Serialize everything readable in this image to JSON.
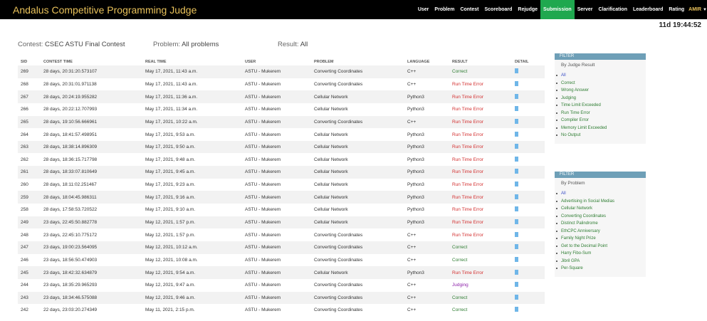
{
  "navbar": {
    "brand": "Andalus Competitive Programming Judge",
    "items": [
      "User",
      "Problem",
      "Contest",
      "Scoreboard",
      "Rejudge",
      "Submission",
      "Server",
      "Clarification",
      "Leaderboard",
      "Rating"
    ],
    "active": "Submission",
    "user": "AMIR"
  },
  "timer": "11d 19:44:52",
  "filters": {
    "contest_label": "Contest: ",
    "contest_value": "CSEC ASTU Final Contest",
    "problem_label": "Problem: ",
    "problem_value": "All problems",
    "result_label": "Result: ",
    "result_value": "All"
  },
  "table": {
    "headers": [
      "SID",
      "CONTEST TIME",
      "REAL TIME",
      "USER",
      "PROBLEM",
      "LANGUAGE",
      "RESULT",
      "DETAIL"
    ],
    "rows": [
      {
        "sid": "269",
        "contest_time": "28 days, 20:31:20.573107",
        "real_time": "May 17, 2021, 11:43 a.m.",
        "user": "ASTU - Mukerem",
        "problem": "Converting Coordinates",
        "language": "C++",
        "result": "Correct"
      },
      {
        "sid": "268",
        "contest_time": "28 days, 20:31:01.971138",
        "real_time": "May 17, 2021, 11:43 a.m.",
        "user": "ASTU - Mukerem",
        "problem": "Converting Coordinates",
        "language": "C++",
        "result": "Run Time Error"
      },
      {
        "sid": "267",
        "contest_time": "28 days, 20:24:19.955282",
        "real_time": "May 17, 2021, 11:36 a.m.",
        "user": "ASTU - Mukerem",
        "problem": "Cellular Network",
        "language": "Python3",
        "result": "Run Time Error"
      },
      {
        "sid": "266",
        "contest_time": "28 days, 20:22:12.707993",
        "real_time": "May 17, 2021, 11:34 a.m.",
        "user": "ASTU - Mukerem",
        "problem": "Cellular Network",
        "language": "Python3",
        "result": "Run Time Error"
      },
      {
        "sid": "265",
        "contest_time": "28 days, 19:10:56.666961",
        "real_time": "May 17, 2021, 10:22 a.m.",
        "user": "ASTU - Mukerem",
        "problem": "Converting Coordinates",
        "language": "C++",
        "result": "Run Time Error"
      },
      {
        "sid": "264",
        "contest_time": "28 days, 18:41:57.498951",
        "real_time": "May 17, 2021, 9:53 a.m.",
        "user": "ASTU - Mukerem",
        "problem": "Cellular Network",
        "language": "Python3",
        "result": "Run Time Error"
      },
      {
        "sid": "263",
        "contest_time": "28 days, 18:38:14.896309",
        "real_time": "May 17, 2021, 9:50 a.m.",
        "user": "ASTU - Mukerem",
        "problem": "Cellular Network",
        "language": "Python3",
        "result": "Run Time Error"
      },
      {
        "sid": "262",
        "contest_time": "28 days, 18:36:15.717798",
        "real_time": "May 17, 2021, 9:48 a.m.",
        "user": "ASTU - Mukerem",
        "problem": "Cellular Network",
        "language": "Python3",
        "result": "Run Time Error"
      },
      {
        "sid": "261",
        "contest_time": "28 days, 18:33:07.810649",
        "real_time": "May 17, 2021, 9:45 a.m.",
        "user": "ASTU - Mukerem",
        "problem": "Cellular Network",
        "language": "Python3",
        "result": "Run Time Error"
      },
      {
        "sid": "260",
        "contest_time": "28 days, 18:11:02.251467",
        "real_time": "May 17, 2021, 9:23 a.m.",
        "user": "ASTU - Mukerem",
        "problem": "Cellular Network",
        "language": "Python3",
        "result": "Run Time Error"
      },
      {
        "sid": "259",
        "contest_time": "28 days, 18:04:45.986311",
        "real_time": "May 17, 2021, 9:16 a.m.",
        "user": "ASTU - Mukerem",
        "problem": "Cellular Network",
        "language": "Python3",
        "result": "Run Time Error"
      },
      {
        "sid": "258",
        "contest_time": "28 days, 17:58:53.720522",
        "real_time": "May 17, 2021, 9:10 a.m.",
        "user": "ASTU - Mukerem",
        "problem": "Cellular Network",
        "language": "Python3",
        "result": "Run Time Error"
      },
      {
        "sid": "249",
        "contest_time": "23 days, 22:45:50.882778",
        "real_time": "May 12, 2021, 1:57 p.m.",
        "user": "ASTU - Mukerem",
        "problem": "Cellular Network",
        "language": "Python3",
        "result": "Run Time Error"
      },
      {
        "sid": "248",
        "contest_time": "23 days, 22:45:10.775172",
        "real_time": "May 12, 2021, 1:57 p.m.",
        "user": "ASTU - Mukerem",
        "problem": "Converting Coordinates",
        "language": "C++",
        "result": "Run Time Error"
      },
      {
        "sid": "247",
        "contest_time": "23 days, 19:00:23.564095",
        "real_time": "May 12, 2021, 10:12 a.m.",
        "user": "ASTU - Mukerem",
        "problem": "Converting Coordinates",
        "language": "C++",
        "result": "Correct"
      },
      {
        "sid": "246",
        "contest_time": "23 days, 18:56:50.474903",
        "real_time": "May 12, 2021, 10:08 a.m.",
        "user": "ASTU - Mukerem",
        "problem": "Converting Coordinates",
        "language": "C++",
        "result": "Correct"
      },
      {
        "sid": "245",
        "contest_time": "23 days, 18:42:32.634879",
        "real_time": "May 12, 2021, 9:54 a.m.",
        "user": "ASTU - Mukerem",
        "problem": "Cellular Network",
        "language": "Python3",
        "result": "Run Time Error"
      },
      {
        "sid": "244",
        "contest_time": "23 days, 18:35:29.965293",
        "real_time": "May 12, 2021, 9:47 a.m.",
        "user": "ASTU - Mukerem",
        "problem": "Converting Coordinates",
        "language": "C++",
        "result": "Judging"
      },
      {
        "sid": "243",
        "contest_time": "23 days, 18:34:46.575088",
        "real_time": "May 12, 2021, 9:46 a.m.",
        "user": "ASTU - Mukerem",
        "problem": "Converting Coordinates",
        "language": "C++",
        "result": "Correct"
      },
      {
        "sid": "242",
        "contest_time": "22 days, 23:03:20.274349",
        "real_time": "May 11, 2021, 2:15 p.m.",
        "user": "ASTU - Mukerem",
        "problem": "Converting Coordinates",
        "language": "C++",
        "result": "Correct"
      }
    ]
  },
  "filter_result": {
    "head": "FILTER",
    "sub": "By Judge Result",
    "items": [
      "All",
      "Correct",
      "Wrong Answer",
      "Judging",
      "Time Limit Exceeded",
      "Run Time Error",
      "Compiler Error",
      "Memory Limit Exceeded",
      "No Output"
    ]
  },
  "filter_problem": {
    "head": "FILTER",
    "sub": "By Problem",
    "items": [
      "All",
      "Advertising in Social Medias",
      "Cellular Network",
      "Converting Coordinates",
      "Distinct Palindrome",
      "EthCPC Anniversary",
      "Family Night Prize",
      "Get to the Decimal Point",
      "Harry Fibo-Sum",
      "Jibril GPA",
      "Per-Square"
    ]
  },
  "colors": {
    "correct": "#2e7d32",
    "run_time_error": "#d32f2f",
    "judging": "#8e24aa",
    "nav_active": "#1fa84f",
    "brand": "#e8c15a",
    "filter_head": "#6e9fb7"
  }
}
